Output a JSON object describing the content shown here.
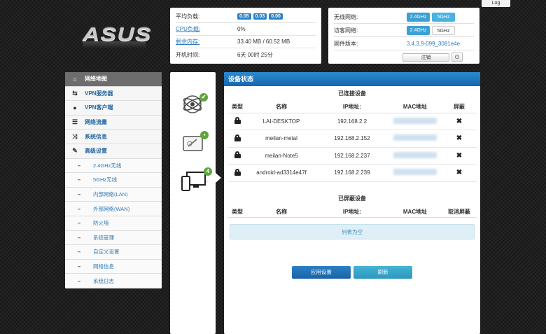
{
  "log_button": "Log",
  "brand": "ASUS",
  "stats": {
    "load_label": "平均负载:",
    "load_values": [
      "0.05",
      "0.03",
      "0.00"
    ],
    "cpu_label": "CPU负载:",
    "cpu_value": "0%",
    "mem_label": "剩余内存:",
    "mem_value": "33.40 MB / 60.52 MB",
    "uptime_label": "开机时间:",
    "uptime_value": "6天 00时 25分"
  },
  "network": {
    "wireless_label": "无线网络:",
    "guest_label": "访客网络:",
    "band_24": "2.4GHz",
    "band_5": "5GHz",
    "firmware_label": "固件版本:",
    "firmware_value": "3.4.3.9-099_3081e4e",
    "logout_label": "注销",
    "power_icon": "power-icon"
  },
  "menu": {
    "items": [
      {
        "label": "网络地图",
        "icon": "home-icon"
      },
      {
        "label": "VPN服务器",
        "icon": "swap-icon"
      },
      {
        "label": "VPN客户端",
        "icon": "globe-icon"
      },
      {
        "label": "网络流量",
        "icon": "bars-icon"
      },
      {
        "label": "系统信息",
        "icon": "shuffle-icon"
      },
      {
        "label": "高级设置",
        "icon": "wrench-icon"
      }
    ],
    "subitems": [
      "2.4GHz无线",
      "5GHz无线",
      "内部网络(LAN)",
      "外部网络(WAN)",
      "防火墙",
      "系统管理",
      "自定义设置",
      "网络信息",
      "系统日志"
    ]
  },
  "side_icons": {
    "router_badge": "✔",
    "internet_badge": "🔒",
    "clients_badge": "4"
  },
  "main": {
    "header": "设备状态",
    "connected_title": "已连接设备",
    "columns": {
      "type": "类型",
      "name": "名称",
      "ip": "IP地址:",
      "mac": "MAC地址",
      "block": "屏蔽"
    },
    "devices": [
      {
        "name": "LAI-DESKTOP",
        "ip": "192.168.2.2"
      },
      {
        "name": "meilan-metal",
        "ip": "192.168.2.152"
      },
      {
        "name": "meilan-Note5",
        "ip": "192.168.2.237"
      },
      {
        "name": "android-ad3314e47f",
        "ip": "192.168.2.239"
      }
    ],
    "blocked_title": "已屏蔽设备",
    "blocked_columns": {
      "type": "类型",
      "name": "名称",
      "ip": "IP地址:",
      "mac": "MAC地址",
      "unblock": "取消屏蔽"
    },
    "empty_text": "列表为空",
    "apply_label": "应用设置",
    "refresh_label": "刷新"
  }
}
